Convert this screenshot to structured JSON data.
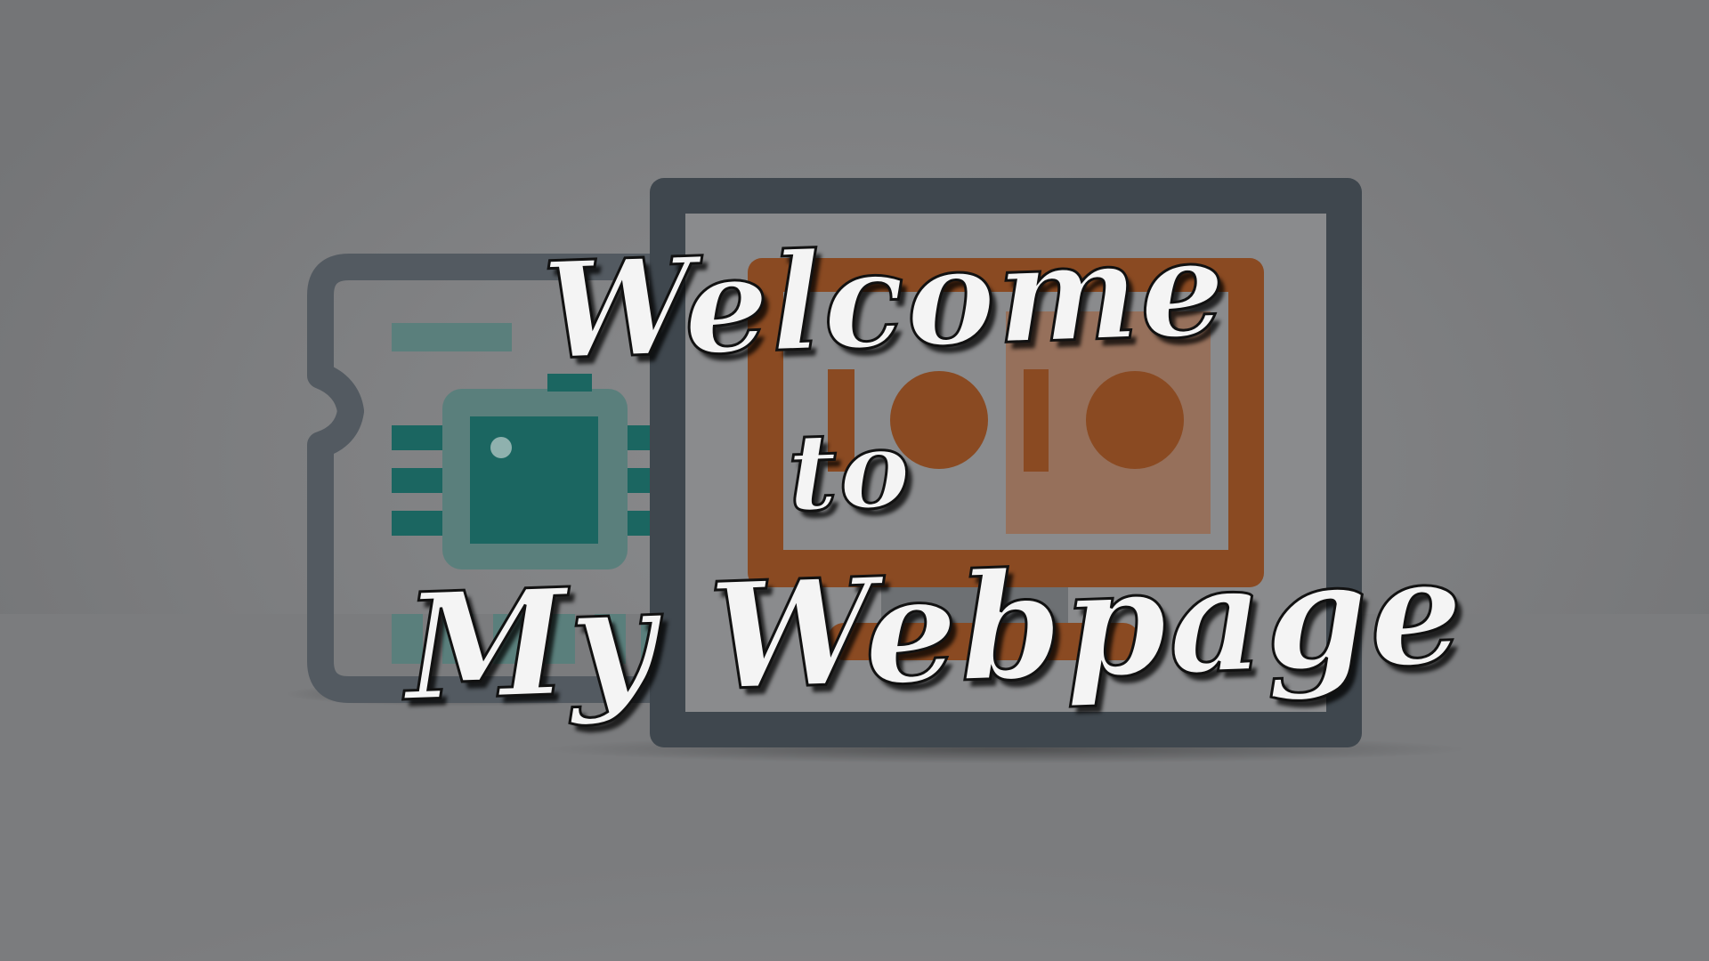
{
  "title": {
    "line1": "Welcome",
    "line2": "to",
    "line3": "My Webpage"
  },
  "colors": {
    "background": "#808183",
    "frame": "#3f474e",
    "card_outline": "#535a61",
    "teal_chip": "#1b6661",
    "teal_light": "#5a7f7c",
    "orange": "#8a4a22",
    "text_fill": "#f4f4f4",
    "text_outline": "#111111"
  },
  "icons": {
    "left": "memory-card-icon",
    "right": "monitor-icon"
  }
}
